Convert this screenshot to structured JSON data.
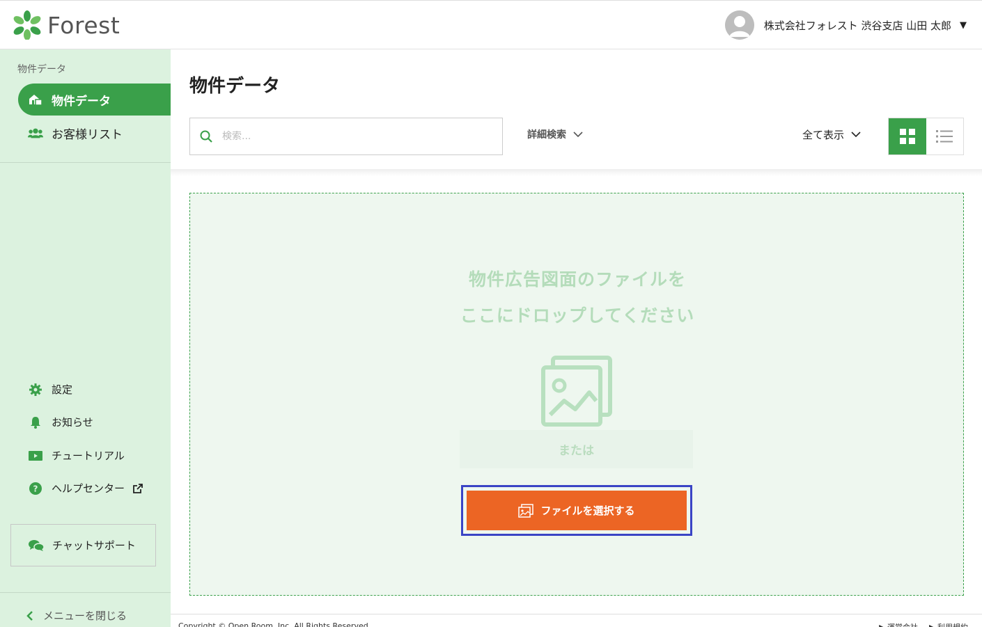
{
  "app": {
    "logo_text": "Forest",
    "brand_color": "#3aa04a",
    "accent_color": "#ec6524"
  },
  "header": {
    "user_name": "株式会社フォレスト 渋谷支店 山田 太郎",
    "caret": "▼",
    "avatar_icon": "user-avatar-icon"
  },
  "sidebar": {
    "section_label": "物件データ",
    "items": [
      {
        "label": "物件データ",
        "icon": "house-icon",
        "active": true
      },
      {
        "label": "お客様リスト",
        "icon": "users-icon",
        "active": false
      }
    ],
    "bottom_items": [
      {
        "label": "設定",
        "icon": "gear-icon"
      },
      {
        "label": "お知らせ",
        "icon": "bell-icon"
      },
      {
        "label": "チュートリアル",
        "icon": "video-icon"
      },
      {
        "label": "ヘルプセンター",
        "icon": "help-icon"
      }
    ],
    "chat_label": "チャットサポート",
    "close_menu_label": "メニューを閉じる"
  },
  "main": {
    "title": "物件データ",
    "search_placeholder": "検索...",
    "advanced_search_label": "詳細検索",
    "filter_label": "全て表示",
    "dropzone": {
      "line1": "物件広告図面のファイルを",
      "line2": "ここにドロップしてください",
      "or_label": "または",
      "select_button_label": "ファイルを選択する"
    }
  },
  "footer": {
    "copyright": "Copyright © Open Room, Inc. All Rights Reserved.",
    "links": [
      "▶ 運営会社",
      "▶ 利用規約"
    ]
  }
}
